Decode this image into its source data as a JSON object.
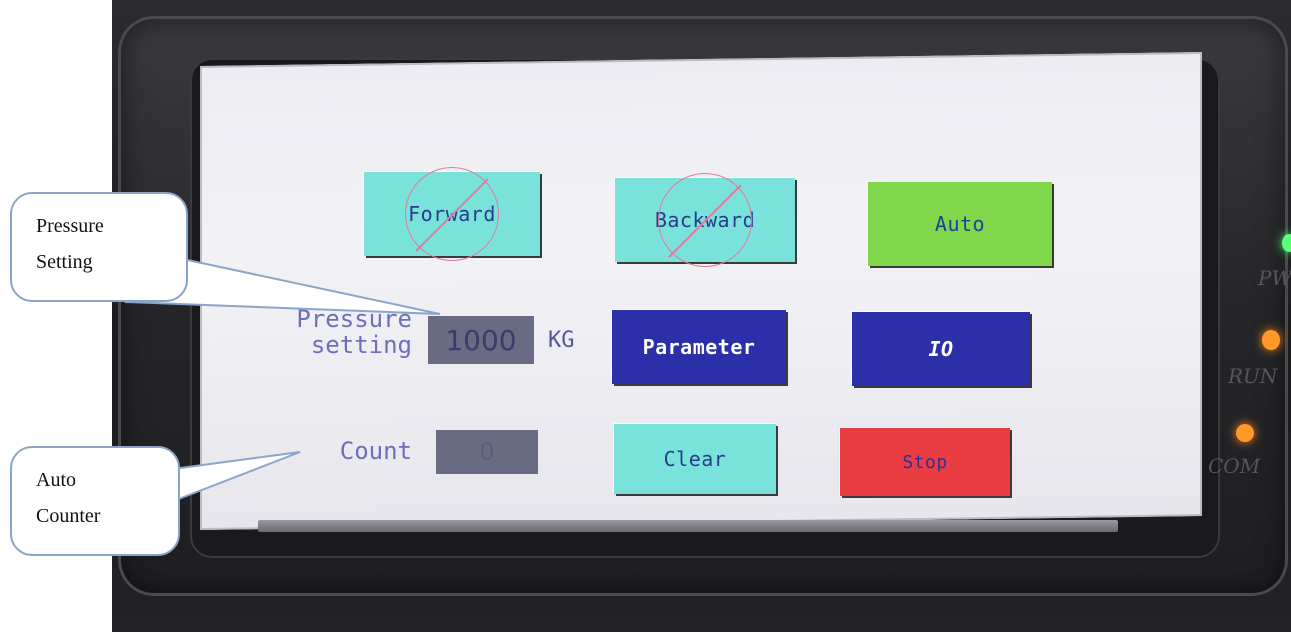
{
  "hmi": {
    "buttons": {
      "forward": "Forward",
      "backward": "Backward",
      "auto": "Auto",
      "parameter": "Parameter",
      "io": "IO",
      "clear": "Clear",
      "stop": "Stop"
    },
    "pressure": {
      "label_line1": "Pressure",
      "label_line2": "setting",
      "value": "1000",
      "unit": "KG"
    },
    "count": {
      "label": "Count",
      "value": "0"
    },
    "colors": {
      "cyan": "#79e3db",
      "green": "#7fd84a",
      "blue": "#2b2fa8",
      "red": "#ea3d42",
      "value_box": "#696b82"
    }
  },
  "indicators": {
    "pwr": "PWR",
    "run": "RUN",
    "com": "COM"
  },
  "annotations": {
    "pressure_callout_line1": "Pressure",
    "pressure_callout_line2": "Setting",
    "counter_callout_line1": "Auto",
    "counter_callout_line2": "Counter"
  }
}
